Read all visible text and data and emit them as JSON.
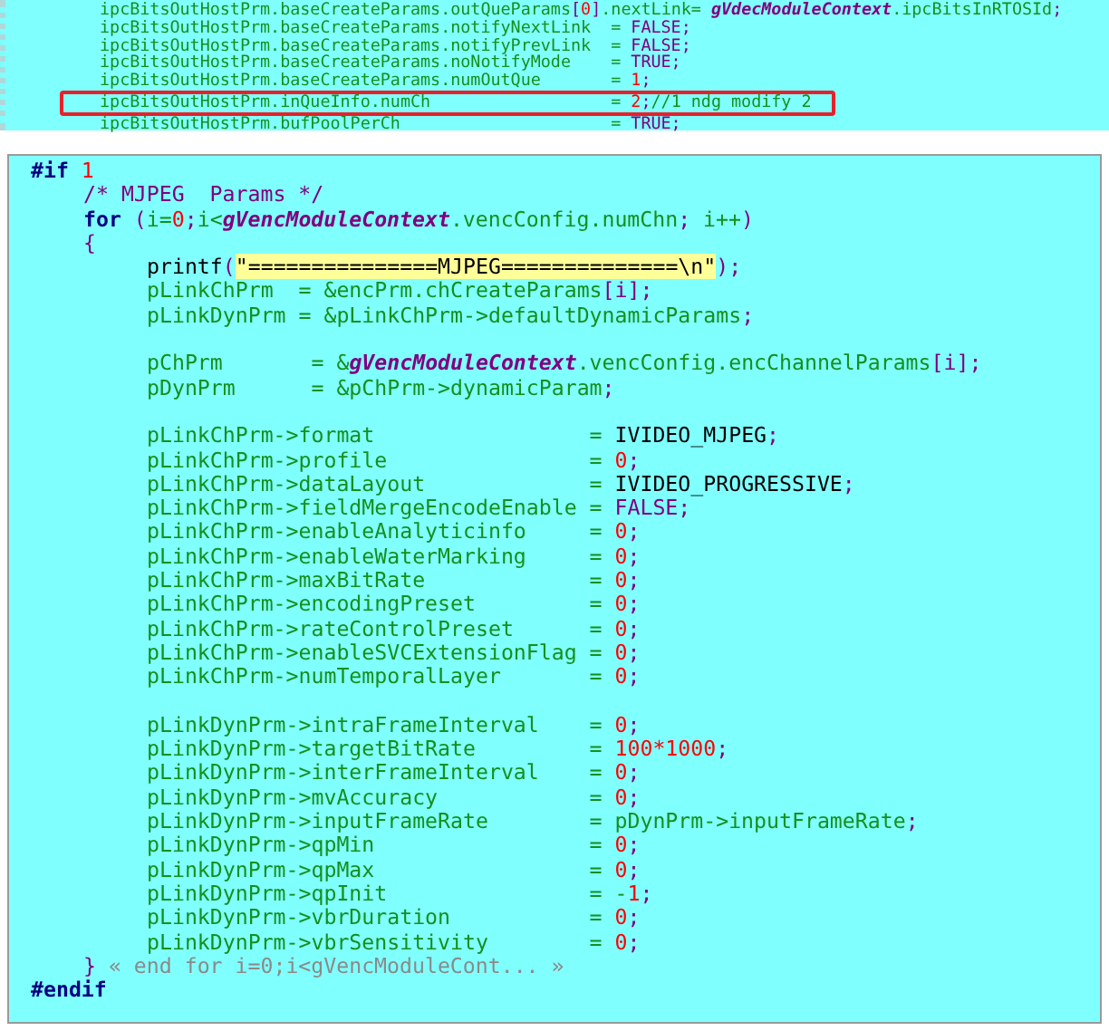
{
  "top_panel": {
    "lines": [
      {
        "marked": false,
        "tokens": [
          {
            "kind": "id",
            "text": "ipcBitsOutHostPrm.baseCreateParams.outQueParams"
          },
          {
            "kind": "op",
            "text": "["
          },
          {
            "kind": "num",
            "text": "0"
          },
          {
            "kind": "op",
            "text": "]"
          },
          {
            "kind": "id",
            "text": ".nextLink= "
          },
          {
            "kind": "glob",
            "text": "gVdecModuleContext"
          },
          {
            "kind": "id",
            "text": ".ipcBitsInRTOSId"
          },
          {
            "kind": "op",
            "text": ";"
          }
        ]
      },
      {
        "marked": false,
        "tokens": [
          {
            "kind": "id",
            "text": "ipcBitsOutHostPrm.baseCreateParams.notifyNextLink  = "
          },
          {
            "kind": "op",
            "text": "FALSE;"
          }
        ]
      },
      {
        "marked": false,
        "tokens": [
          {
            "kind": "id",
            "text": "ipcBitsOutHostPrm.baseCreateParams.notifyPrevLink  = "
          },
          {
            "kind": "op",
            "text": "FALSE;"
          }
        ]
      },
      {
        "marked": false,
        "tokens": [
          {
            "kind": "id",
            "text": "ipcBitsOutHostPrm.baseCreateParams.noNotifyMode    = "
          },
          {
            "kind": "op",
            "text": "TRUE;"
          }
        ]
      },
      {
        "marked": false,
        "tokens": [
          {
            "kind": "id",
            "text": "ipcBitsOutHostPrm.baseCreateParams.numOutQue       = "
          },
          {
            "kind": "num",
            "text": "1"
          },
          {
            "kind": "op",
            "text": ";"
          }
        ]
      },
      {
        "marked": true,
        "tokens": [
          {
            "kind": "id",
            "text": "ipcBitsOutHostPrm.inQueInfo.numCh                  = "
          },
          {
            "kind": "num",
            "text": "2"
          },
          {
            "kind": "op",
            "text": ";"
          },
          {
            "kind": "id",
            "text": "//1 ndg modify 2"
          }
        ]
      },
      {
        "marked": false,
        "tokens": [
          {
            "kind": "id",
            "text": "ipcBitsOutHostPrm.bufPoolPerCh                     = "
          },
          {
            "kind": "op",
            "text": "TRUE;"
          }
        ]
      }
    ]
  },
  "editor": {
    "lines": [
      {
        "tokens": [
          {
            "kind": "kw",
            "text": "#if "
          },
          {
            "kind": "num",
            "text": "1"
          }
        ],
        "children": [
          {
            "tokens": [
              {
                "kind": "cmt",
                "text": "/* MJPEG  Params */"
              }
            ]
          },
          {
            "tokens": [
              {
                "kind": "kw",
                "text": "for "
              },
              {
                "kind": "op",
                "text": "("
              },
              {
                "kind": "id",
                "text": "i="
              },
              {
                "kind": "num",
                "text": "0"
              },
              {
                "kind": "op",
                "text": ";"
              },
              {
                "kind": "id",
                "text": "i<"
              },
              {
                "kind": "glob",
                "text": "gVencModuleContext"
              },
              {
                "kind": "id",
                "text": ".vencConfig.numChn"
              },
              {
                "kind": "op",
                "text": ";"
              },
              {
                "kind": "id",
                "text": " i++"
              },
              {
                "kind": "op",
                "text": ")"
              }
            ]
          },
          {
            "tokens": [
              {
                "kind": "op",
                "text": "{"
              }
            ],
            "children": [
              {
                "tokens": [
                  {
                    "kind": "plain",
                    "text": "printf"
                  },
                  {
                    "kind": "op",
                    "text": "("
                  },
                  {
                    "kind": "str",
                    "text": "\"===============MJPEG==============\\n\""
                  },
                  {
                    "kind": "op",
                    "text": ");"
                  }
                ]
              },
              {
                "tokens": [
                  {
                    "kind": "id",
                    "text": "pLinkChPrm  = &encPrm.chCreateParams"
                  },
                  {
                    "kind": "op",
                    "text": "[i];"
                  }
                ]
              },
              {
                "tokens": [
                  {
                    "kind": "id",
                    "text": "pLinkDynPrm = &pLinkChPrm->defaultDynamicParams"
                  },
                  {
                    "kind": "op",
                    "text": ";"
                  }
                ]
              },
              {
                "kind": "blank"
              },
              {
                "tokens": [
                  {
                    "kind": "id",
                    "text": "pChPrm       = &"
                  },
                  {
                    "kind": "glob",
                    "text": "gVencModuleContext"
                  },
                  {
                    "kind": "id",
                    "text": ".vencConfig.encChannelParams"
                  },
                  {
                    "kind": "op",
                    "text": "[i];"
                  }
                ]
              },
              {
                "tokens": [
                  {
                    "kind": "id",
                    "text": "pDynPrm      = &pChPrm->dynamicParam"
                  },
                  {
                    "kind": "op",
                    "text": ";"
                  }
                ]
              },
              {
                "kind": "blank"
              },
              {
                "tokens": [
                  {
                    "kind": "id",
                    "text": "pLinkChPrm->format                 = "
                  },
                  {
                    "kind": "plain",
                    "text": "IVIDEO_MJPEG"
                  },
                  {
                    "kind": "op",
                    "text": ";"
                  }
                ]
              },
              {
                "tokens": [
                  {
                    "kind": "id",
                    "text": "pLinkChPrm->profile                = "
                  },
                  {
                    "kind": "num",
                    "text": "0"
                  },
                  {
                    "kind": "op",
                    "text": ";"
                  }
                ]
              },
              {
                "tokens": [
                  {
                    "kind": "id",
                    "text": "pLinkChPrm->dataLayout             = "
                  },
                  {
                    "kind": "plain",
                    "text": "IVIDEO_PROGRESSIVE"
                  },
                  {
                    "kind": "op",
                    "text": ";"
                  }
                ]
              },
              {
                "tokens": [
                  {
                    "kind": "id",
                    "text": "pLinkChPrm->fieldMergeEncodeEnable = "
                  },
                  {
                    "kind": "op",
                    "text": "FALSE;"
                  }
                ]
              },
              {
                "tokens": [
                  {
                    "kind": "id",
                    "text": "pLinkChPrm->enableAnalyticinfo     = "
                  },
                  {
                    "kind": "num",
                    "text": "0"
                  },
                  {
                    "kind": "op",
                    "text": ";"
                  }
                ]
              },
              {
                "tokens": [
                  {
                    "kind": "id",
                    "text": "pLinkChPrm->enableWaterMarking     = "
                  },
                  {
                    "kind": "num",
                    "text": "0"
                  },
                  {
                    "kind": "op",
                    "text": ";"
                  }
                ]
              },
              {
                "tokens": [
                  {
                    "kind": "id",
                    "text": "pLinkChPrm->maxBitRate             = "
                  },
                  {
                    "kind": "num",
                    "text": "0"
                  },
                  {
                    "kind": "op",
                    "text": ";"
                  }
                ]
              },
              {
                "tokens": [
                  {
                    "kind": "id",
                    "text": "pLinkChPrm->encodingPreset         = "
                  },
                  {
                    "kind": "num",
                    "text": "0"
                  },
                  {
                    "kind": "op",
                    "text": ";"
                  }
                ]
              },
              {
                "tokens": [
                  {
                    "kind": "id",
                    "text": "pLinkChPrm->rateControlPreset      = "
                  },
                  {
                    "kind": "num",
                    "text": "0"
                  },
                  {
                    "kind": "op",
                    "text": ";"
                  }
                ]
              },
              {
                "tokens": [
                  {
                    "kind": "id",
                    "text": "pLinkChPrm->enableSVCExtensionFlag = "
                  },
                  {
                    "kind": "num",
                    "text": "0"
                  },
                  {
                    "kind": "op",
                    "text": ";"
                  }
                ]
              },
              {
                "tokens": [
                  {
                    "kind": "id",
                    "text": "pLinkChPrm->numTemporalLayer       = "
                  },
                  {
                    "kind": "num",
                    "text": "0"
                  },
                  {
                    "kind": "op",
                    "text": ";"
                  }
                ]
              },
              {
                "kind": "blank"
              },
              {
                "tokens": [
                  {
                    "kind": "id",
                    "text": "pLinkDynPrm->intraFrameInterval    = "
                  },
                  {
                    "kind": "num",
                    "text": "0"
                  },
                  {
                    "kind": "op",
                    "text": ";"
                  }
                ]
              },
              {
                "tokens": [
                  {
                    "kind": "id",
                    "text": "pLinkDynPrm->targetBitRate         = "
                  },
                  {
                    "kind": "num",
                    "text": "100*1000"
                  },
                  {
                    "kind": "op",
                    "text": ";"
                  }
                ]
              },
              {
                "tokens": [
                  {
                    "kind": "id",
                    "text": "pLinkDynPrm->interFrameInterval    = "
                  },
                  {
                    "kind": "num",
                    "text": "0"
                  },
                  {
                    "kind": "op",
                    "text": ";"
                  }
                ]
              },
              {
                "tokens": [
                  {
                    "kind": "id",
                    "text": "pLinkDynPrm->mvAccuracy            = "
                  },
                  {
                    "kind": "num",
                    "text": "0"
                  },
                  {
                    "kind": "op",
                    "text": ";"
                  }
                ]
              },
              {
                "tokens": [
                  {
                    "kind": "id",
                    "text": "pLinkDynPrm->inputFrameRate        = pDynPrm->inputFrameRate"
                  },
                  {
                    "kind": "op",
                    "text": ";"
                  }
                ]
              },
              {
                "tokens": [
                  {
                    "kind": "id",
                    "text": "pLinkDynPrm->qpMin                 = "
                  },
                  {
                    "kind": "num",
                    "text": "0"
                  },
                  {
                    "kind": "op",
                    "text": ";"
                  }
                ]
              },
              {
                "tokens": [
                  {
                    "kind": "id",
                    "text": "pLinkDynPrm->qpMax                 = "
                  },
                  {
                    "kind": "num",
                    "text": "0"
                  },
                  {
                    "kind": "op",
                    "text": ";"
                  }
                ]
              },
              {
                "tokens": [
                  {
                    "kind": "id",
                    "text": "pLinkDynPrm->qpInit                = -"
                  },
                  {
                    "kind": "num",
                    "text": "1"
                  },
                  {
                    "kind": "op",
                    "text": ";"
                  }
                ]
              },
              {
                "tokens": [
                  {
                    "kind": "id",
                    "text": "pLinkDynPrm->vbrDuration           = "
                  },
                  {
                    "kind": "num",
                    "text": "0"
                  },
                  {
                    "kind": "op",
                    "text": ";"
                  }
                ]
              },
              {
                "tokens": [
                  {
                    "kind": "id",
                    "text": "pLinkDynPrm->vbrSensitivity        = "
                  },
                  {
                    "kind": "num",
                    "text": "0"
                  },
                  {
                    "kind": "op",
                    "text": ";"
                  }
                ]
              }
            ]
          },
          {
            "tokens": [
              {
                "kind": "op",
                "text": "} "
              },
              {
                "kind": "fold",
                "text": "« end for i=0;i<gVencModuleCont... »"
              }
            ]
          }
        ]
      },
      {
        "tokens": [
          {
            "kind": "kw",
            "text": "#endif"
          }
        ]
      }
    ]
  }
}
